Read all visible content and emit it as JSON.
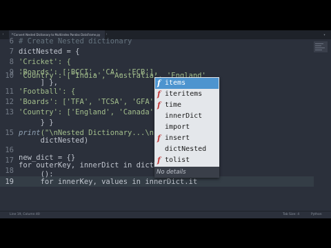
{
  "window": {
    "tab_title": "Convert Nested Dictionary to Multiindex Pandas DataFrame.py"
  },
  "icons": {
    "tab_close": "close-icon",
    "tab_prev": "chevron-left-icon",
    "tab_next": "chevron-right-icon",
    "tab_menu": "chevron-down-icon",
    "completion_kind": "function-icon"
  },
  "gutter": [
    "6",
    "7",
    "8",
    "9",
    "10",
    "",
    "11",
    "12",
    "13",
    "",
    "",
    "15",
    "16",
    "",
    "17",
    "18",
    "",
    "19"
  ],
  "code": {
    "l6": "# Create Nested dictionary",
    "l7": "dictNested = {",
    "l8": "'Cricket': {",
    "l9": "'Boards': ['BCCI', 'CA', 'ECB'],",
    "l10": "'Country': ['India', 'Australia', 'England'",
    "l10b": "     ] },",
    "l11": "'Football': {",
    "l12": "'Boards': ['TFA', 'TCSA', 'GFA'],",
    "l13": "'Country': ['England', 'Canada', 'G",
    "l13b": "     } }",
    "l15_fn": "print",
    "l15_rest": "(\"\\nNested Dictionary...\\n\",",
    "l15b": "     dictNested)",
    "l17": "new_dict = {}",
    "l18": "for outerKey, innerDict in dictNeste",
    "l18b": "     ():",
    "l19": "     for innerKey, values in innerDict.it"
  },
  "autocomplete": {
    "items": [
      {
        "label": "items",
        "kind": "f",
        "selected": true
      },
      {
        "label": "iteritems",
        "kind": "f",
        "selected": false
      },
      {
        "label": "time",
        "kind": "f",
        "selected": false
      },
      {
        "label": "innerDict",
        "kind": "",
        "selected": false
      },
      {
        "label": "import",
        "kind": "",
        "selected": false
      },
      {
        "label": "insert",
        "kind": "f",
        "selected": false
      },
      {
        "label": "dictNested",
        "kind": "",
        "selected": false
      },
      {
        "label": "tolist",
        "kind": "f",
        "selected": false
      }
    ],
    "footer": "No details"
  },
  "status": {
    "position": "Line 19, Column 40",
    "tab_size": "Tab Size: 4",
    "syntax": "Python"
  },
  "colors": {
    "background": "#2b303b",
    "comment": "#65737e",
    "string": "#a3be8c",
    "function": "#8fa1b3",
    "selection": "#4d94cf",
    "kind_icon": "#c23b3b"
  }
}
